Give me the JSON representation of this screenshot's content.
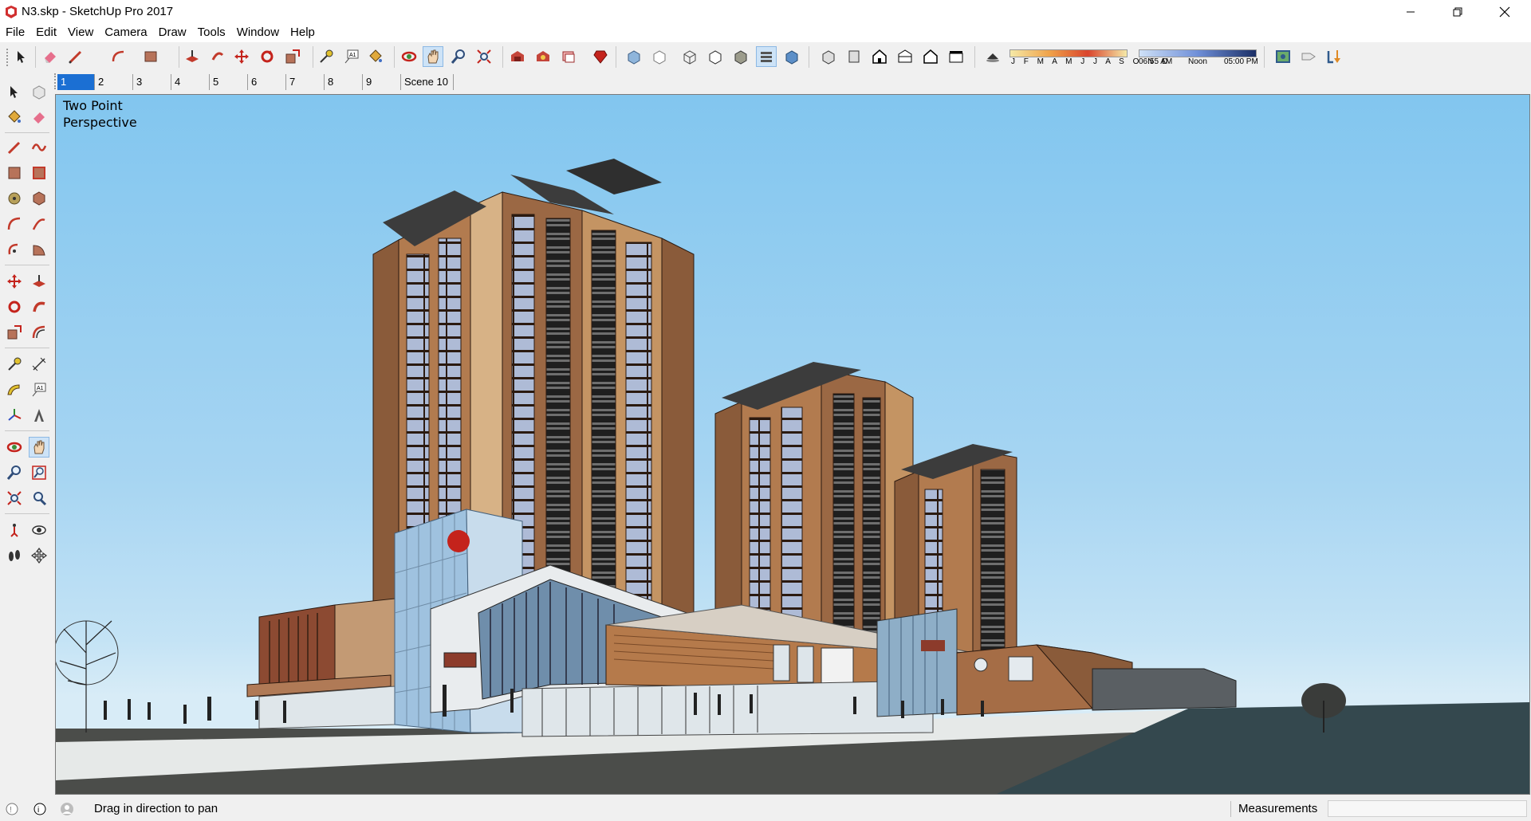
{
  "window": {
    "title": "N3.skp - SketchUp Pro 2017",
    "controls": [
      "minimize",
      "restore",
      "close"
    ]
  },
  "menu": [
    "File",
    "Edit",
    "View",
    "Camera",
    "Draw",
    "Tools",
    "Window",
    "Help"
  ],
  "toolbar": {
    "tools": [
      "select-icon",
      "eraser-icon",
      "line-icon",
      "arc-icon",
      "rectangle-icon",
      "push-pull-icon",
      "follow-me-icon",
      "move-icon",
      "rotate-icon",
      "scale-icon",
      "tape-measure-icon",
      "text-icon",
      "paint-bucket-icon",
      "orbit-icon",
      "pan-icon",
      "zoom-icon",
      "zoom-extents-icon",
      "warehouse-icon",
      "extension-warehouse-icon",
      "layout-icon",
      "ruby-icon",
      "xray-icon",
      "back-edges-icon",
      "wireframe-icon",
      "hidden-line-icon",
      "shaded-icon",
      "shaded-textures-icon",
      "monochrome-icon",
      "iso-view-icon",
      "top-view-icon",
      "front-view-icon",
      "right-view-icon",
      "back-view-icon",
      "left-view-icon",
      "shadows-icon",
      "location-icon",
      "tag-icon",
      "download-icon"
    ],
    "shadow_months": "J F M A M J J A S O N D",
    "time_start": "06:55 AM",
    "time_mid": "Noon",
    "time_end": "05:00 PM"
  },
  "scenes": {
    "tabs": [
      "1",
      "2",
      "3",
      "4",
      "5",
      "6",
      "7",
      "8",
      "9",
      "Scene 10"
    ],
    "active_index": 0
  },
  "left_tools": [
    [
      "select-icon",
      "component-icon"
    ],
    [
      "paint-bucket-icon",
      "eraser-icon"
    ],
    [
      "line-icon",
      "freehand-icon"
    ],
    [
      "rectangle-icon",
      "rotated-rectangle-icon"
    ],
    [
      "circle-icon",
      "polygon-icon"
    ],
    [
      "arc-icon",
      "two-point-arc-icon"
    ],
    [
      "three-point-arc-icon",
      "pie-icon"
    ],
    [
      "move-icon",
      "push-pull-icon"
    ],
    [
      "rotate-icon",
      "follow-me-icon"
    ],
    [
      "scale-icon",
      "offset-icon"
    ],
    [
      "tape-measure-icon",
      "dimension-icon"
    ],
    [
      "protractor-icon",
      "text-icon"
    ],
    [
      "axes-icon",
      "3d-text-icon"
    ],
    [
      "orbit-icon",
      "pan-icon"
    ],
    [
      "zoom-icon",
      "zoom-window-icon"
    ],
    [
      "zoom-extents-icon",
      "previous-view-icon"
    ],
    [
      "position-camera-icon",
      "look-around-icon"
    ],
    [
      "walk-icon",
      "section-plane-icon"
    ]
  ],
  "viewport": {
    "camera_label_line1": "Two Point",
    "camera_label_line2": "Perspective",
    "scene_description": "3D model of high-rise residential towers with a commercial podium"
  },
  "status": {
    "hint": "Drag in direction to pan",
    "measurements_label": "Measurements",
    "measurements_value": ""
  },
  "colors": {
    "sky": "#82c6ef",
    "tower_brown": "#9a6a45",
    "tower_light": "#caa27a",
    "glass": "#b9d4ea",
    "ground": "#4d4f4c",
    "active_tab": "#1b6fd3"
  }
}
